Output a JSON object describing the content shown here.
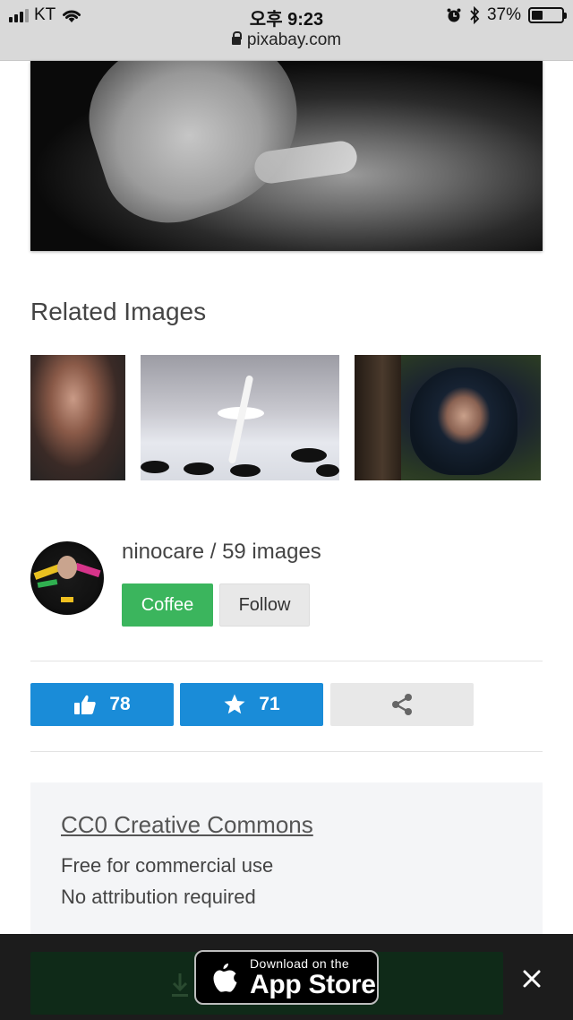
{
  "status_bar": {
    "carrier": "KT",
    "time": "오후 9:23",
    "url": "pixabay.com",
    "battery": "37%",
    "battery_level": 0.37
  },
  "related": {
    "title": "Related Images"
  },
  "user": {
    "name_line": "ninocare / 59 images",
    "coffee_label": "Coffee",
    "follow_label": "Follow"
  },
  "actions": {
    "likes": "78",
    "favorites": "71"
  },
  "license": {
    "title": "CC0 Creative Commons",
    "line1": "Free for commercial use",
    "line2": "No attribution required"
  },
  "app_banner": {
    "small_text": "Download on the",
    "big_text": "App Store"
  },
  "colors": {
    "coffee": "#3bb55d",
    "action_blue": "#1a8cd8",
    "banner_bg": "#1c1c1c"
  },
  "icons": [
    "wifi-icon",
    "lock-icon",
    "alarm-icon",
    "bluetooth-icon",
    "battery-icon",
    "thumbs-up-icon",
    "star-icon",
    "share-icon",
    "download-icon",
    "apple-icon",
    "close-icon"
  ]
}
